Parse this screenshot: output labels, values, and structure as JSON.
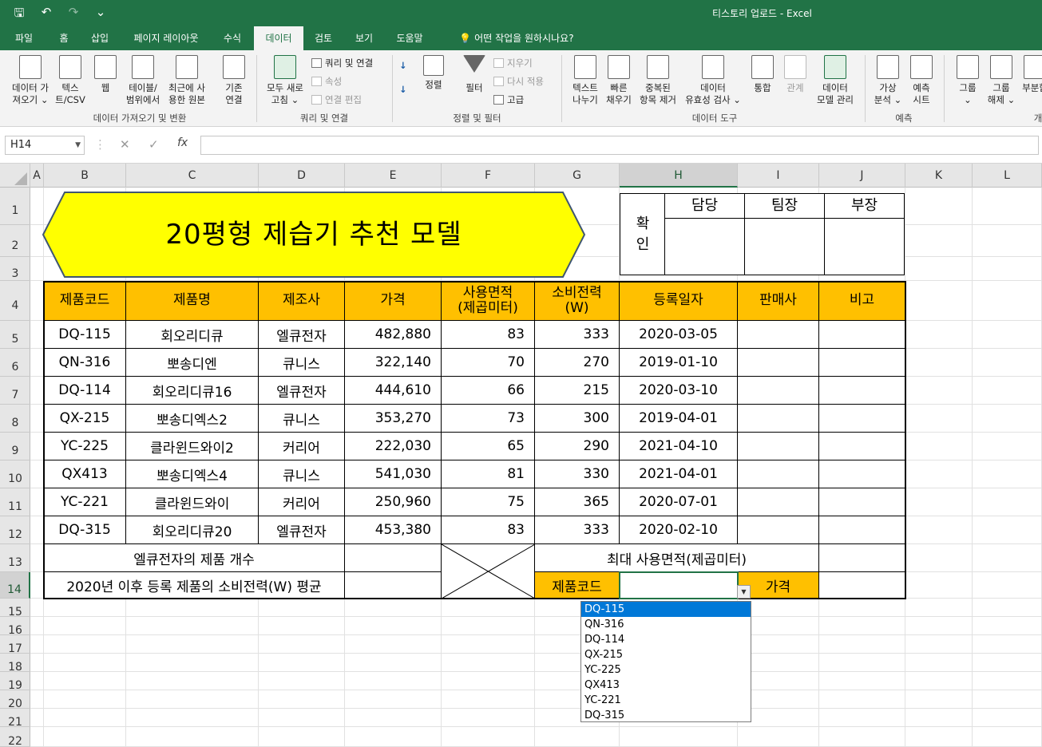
{
  "titlebar": {
    "qat": {
      "save": "🖫",
      "undo": "↶",
      "redo": "↷",
      "customize": "⌄"
    },
    "title": "티스토리 업로드  -  Excel"
  },
  "tabs": [
    "파일",
    "홈",
    "삽입",
    "페이지 레이아웃",
    "수식",
    "데이터",
    "검토",
    "보기",
    "도움말",
    "어떤 작업을 원하시나요?"
  ],
  "active_tab": "데이터",
  "ribbon": {
    "get_data": "데이터 가\n져오기 ⌄",
    "text_csv": "텍스\n트/CSV",
    "web": "웹",
    "table_range": "테이블/\n범위에서",
    "recent_sources": "최근에 사\n용한 원본",
    "existing_conn": "기존\n연결",
    "group_get": "데이터 가져오기 및 변환",
    "refresh_all": "모두 새로\n고침 ⌄",
    "queries_conn": "쿼리 및 연결",
    "properties": "속성",
    "edit_links": "연결 편집",
    "group_queries": "쿼리 및 연결",
    "sort_az": "↓",
    "sort_za": "↓",
    "sort": "정렬",
    "filter": "필터",
    "clear": "지우기",
    "reapply": "다시 적용",
    "advanced": "고급",
    "group_sort": "정렬 및 필터",
    "text_to_columns": "텍스트\n나누기",
    "flash_fill": "빠른\n채우기",
    "remove_dup": "중복된\n항목 제거",
    "validation": "데이터\n유효성 검사 ⌄",
    "consolidate": "통합",
    "relations": "관계",
    "data_model": "데이터\n모델 관리",
    "group_tools": "데이터 도구",
    "what_if": "가상\n분석 ⌄",
    "forecast_sheet": "예측\n시트",
    "group_forecast": "예측",
    "group_btn": "그룹\n⌄",
    "ungroup": "그룹\n해제 ⌄",
    "subtotal": "부분합",
    "group_outline": "개"
  },
  "formula_bar": {
    "name_box": "H14",
    "cancel": "✕",
    "enter": "✓",
    "fx": "fx",
    "formula": ""
  },
  "columns": [
    "A",
    "B",
    "C",
    "D",
    "E",
    "F",
    "G",
    "H",
    "I",
    "J",
    "K",
    "L"
  ],
  "rows": [
    "1",
    "2",
    "3",
    "4",
    "5",
    "6",
    "7",
    "8",
    "9",
    "10",
    "11",
    "12",
    "13",
    "14",
    "15",
    "16",
    "17",
    "18",
    "19",
    "20",
    "21",
    "22"
  ],
  "selected_cell": "H14",
  "title_shape": {
    "text": "20평형 제습기 추천 모델",
    "fill": "#ffff00"
  },
  "approval": {
    "label": "확\n인",
    "headers": [
      "담당",
      "팀장",
      "부장"
    ]
  },
  "table": {
    "headers": [
      "제품코드",
      "제품명",
      "제조사",
      "가격",
      "사용면적\n(제곱미터)",
      "소비전력\n(W)",
      "등록일자",
      "판매사",
      "비고"
    ],
    "rows": [
      [
        "DQ-115",
        "회오리디큐",
        "엘큐전자",
        "482,880",
        "83",
        "333",
        "2020-03-05",
        "",
        ""
      ],
      [
        "QN-316",
        "뽀송디엔",
        "큐니스",
        "322,140",
        "70",
        "270",
        "2019-01-10",
        "",
        ""
      ],
      [
        "DQ-114",
        "회오리디큐16",
        "엘큐전자",
        "444,610",
        "66",
        "215",
        "2020-03-10",
        "",
        ""
      ],
      [
        "QX-215",
        "뽀송디엑스2",
        "큐니스",
        "353,270",
        "73",
        "300",
        "2019-04-01",
        "",
        ""
      ],
      [
        "YC-225",
        "클라윈드와이2",
        "커리어",
        "222,030",
        "65",
        "290",
        "2021-04-10",
        "",
        ""
      ],
      [
        "QX413",
        "뽀송디엑스4",
        "큐니스",
        "541,030",
        "81",
        "330",
        "2021-04-01",
        "",
        ""
      ],
      [
        "YC-221",
        "클라윈드와이",
        "커리어",
        "250,960",
        "75",
        "365",
        "2020-07-01",
        "",
        ""
      ],
      [
        "DQ-315",
        "회오리디큐20",
        "엘큐전자",
        "453,380",
        "83",
        "333",
        "2020-02-10",
        "",
        ""
      ]
    ],
    "header_fill": "#ffc000"
  },
  "summary": {
    "row13_label": "엘큐전자의 제품 개수",
    "row14_label": "2020년 이후 등록 제품의 소비전력(W) 평균",
    "max_area_label": "최대 사용면적(제곱미터)",
    "product_code_label": "제품코드",
    "price_label": "가격"
  },
  "dropdown": {
    "options": [
      "DQ-115",
      "QN-316",
      "DQ-114",
      "QX-215",
      "YC-225",
      "QX413",
      "YC-221",
      "DQ-315"
    ],
    "highlighted": "DQ-115",
    "arrow": "▼"
  }
}
